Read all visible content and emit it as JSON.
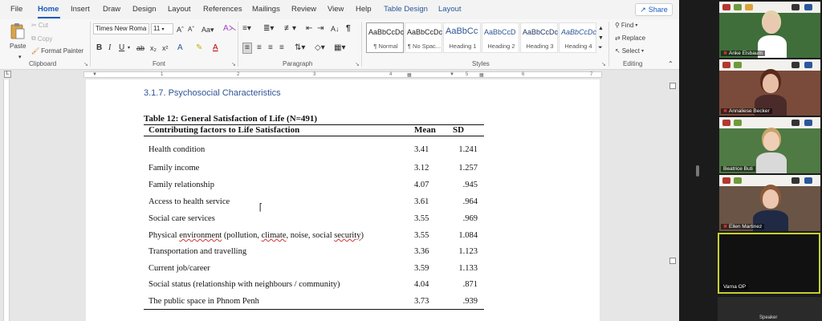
{
  "menubar": {
    "items": [
      "File",
      "Home",
      "Insert",
      "Draw",
      "Design",
      "Layout",
      "References",
      "Mailings",
      "Review",
      "View",
      "Help",
      "Table Design",
      "Layout"
    ],
    "share_label": "Share"
  },
  "ribbon": {
    "clipboard": {
      "paste": "Paste",
      "cut": "Cut",
      "copy": "Copy",
      "format_painter": "Format Painter",
      "group_label": "Clipboard"
    },
    "font": {
      "font_name": "Times New Roma",
      "font_size": "11",
      "group_label": "Font"
    },
    "paragraph": {
      "group_label": "Paragraph"
    },
    "styles": {
      "items": [
        {
          "sample": "AaBbCcDc",
          "name": "¶ Normal"
        },
        {
          "sample": "AaBbCcDc",
          "name": "¶ No Spac..."
        },
        {
          "sample": "AaBbCc",
          "name": "Heading 1"
        },
        {
          "sample": "AaBbCcD",
          "name": "Heading 2"
        },
        {
          "sample": "AaBbCcDc",
          "name": "Heading 3"
        },
        {
          "sample": "AaBbCcDc",
          "name": "Heading 4"
        }
      ],
      "group_label": "Styles"
    },
    "editing": {
      "find": "Find",
      "replace": "Replace",
      "select": "Select",
      "group_label": "Editing"
    }
  },
  "ruler": {
    "numbers": [
      "1",
      "2",
      "3",
      "4",
      "5",
      "6",
      "7"
    ],
    "tab_glyph": "L"
  },
  "document": {
    "section_heading": "3.1.7. Psychosocial Characteristics",
    "table_title": "Table 12: General Satisfaction of Life (N=491)",
    "headers": {
      "factor": "Contributing factors to Life Satisfaction",
      "mean": "Mean",
      "sd": "SD"
    },
    "rows": [
      {
        "factor": "Health condition",
        "mean": "3.41",
        "sd": "1.241"
      },
      {
        "factor": "Family income",
        "mean": "3.12",
        "sd": "1.257"
      },
      {
        "factor": "Family relationship",
        "mean": "4.07",
        "sd": ".945"
      },
      {
        "factor": "Access to health service",
        "mean": "3.61",
        "sd": ".964"
      },
      {
        "factor": "Social care services",
        "mean": "3.55",
        "sd": ".969"
      },
      {
        "factor_parts": [
          "Physical ",
          "environment",
          " (pollution, ",
          "climate",
          ", noise, social ",
          "security",
          ")"
        ],
        "mean": "3.55",
        "sd": "1.084"
      },
      {
        "factor": "Transportation and travelling",
        "mean": "3.36",
        "sd": "1.123"
      },
      {
        "factor": "Current job/career",
        "mean": "3.59",
        "sd": "1.133"
      },
      {
        "factor": "Social status (relationship with neighbours / community)",
        "mean": "4.04",
        "sd": ".871"
      },
      {
        "factor": "The public space in Phnom Penh",
        "mean": "3.73",
        "sd": ".939"
      }
    ]
  },
  "participants": [
    {
      "name": "Anke Elsbaum",
      "muted": true,
      "bg": "#3f6e3a",
      "skin": "#e9c9b1",
      "hair": "#e0d3a8",
      "shirt": "#ffffff"
    },
    {
      "name": "Annaliese Becker",
      "muted": true,
      "bg": "#7a4b3b",
      "skin": "#e7bfa6",
      "hair": "#5a2a1c",
      "shirt": "#4b2a2a"
    },
    {
      "name": "Beatrice Buti",
      "muted": false,
      "bg": "#4f7a44",
      "skin": "#f0cfb6",
      "hair": "#c9a46a",
      "shirt": "#d9d9d9"
    },
    {
      "name": "Ellen Martinez",
      "muted": true,
      "bg": "#6a5446",
      "skin": "#edc7af",
      "hair": "#8a5a3a",
      "shirt": "#202a44"
    }
  ],
  "empty_tile": {
    "name": "Varna OP"
  },
  "bottom_label": "Speaker"
}
